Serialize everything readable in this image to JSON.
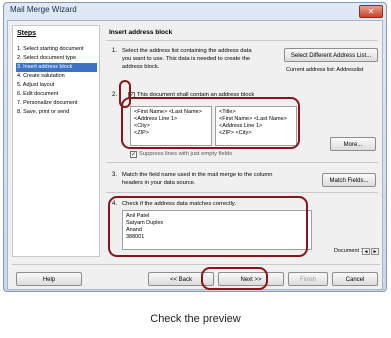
{
  "window": {
    "title": "Mail Merge Wizard",
    "close": "✕"
  },
  "steps": {
    "title": "Steps",
    "items": [
      {
        "label": "1. Select starting document"
      },
      {
        "label": "2. Select document type"
      },
      {
        "label": "3. Insert address block",
        "active": true
      },
      {
        "label": "4. Create salutation"
      },
      {
        "label": "5. Adjust layout"
      },
      {
        "label": "6. Edit document"
      },
      {
        "label": "7. Personalize document"
      },
      {
        "label": "8. Save, print or send"
      }
    ]
  },
  "content": {
    "heading": "Insert address block",
    "section1": {
      "number": "1.",
      "text_line1": "Select the address list containing the address data",
      "text_line2": "you want to use. This data is needed to create the",
      "text_line3": "address block.",
      "button": "Select Different Address List...",
      "current_list": "Current address list: Addresslist"
    },
    "section2": {
      "number": "2.",
      "checkbox_label": "This document shall contain an address block",
      "checked": true,
      "check_mark": "✓",
      "block1": [
        "<First Name> <Last Name>",
        "<Address Line 1>",
        "<City>",
        "<ZIP>"
      ],
      "block2": [
        "<Title>",
        "<First Name> <Last Name>",
        "<Address Line 1>",
        "<ZIP> <City>"
      ],
      "more_button": "More...",
      "suppress_label": "Suppress lines with just empty fields"
    },
    "section3": {
      "number": "3.",
      "text_line1": "Match the field name used in the mail merge to the column",
      "text_line2": "headers in your data source.",
      "button": "Match Fields..."
    },
    "section4": {
      "number": "4.",
      "label": "Check if the address data matches correctly.",
      "preview": [
        "Anil Patel",
        "Satyam Duplex",
        "Anand",
        "388001"
      ],
      "document_label": "Document 1",
      "prev_glyph": "◄",
      "next_glyph": "►"
    }
  },
  "footer": {
    "help": "Help",
    "back": "<< Back",
    "next": "Next >>",
    "finish": "Finish",
    "cancel": "Cancel"
  },
  "caption": "Check the preview"
}
